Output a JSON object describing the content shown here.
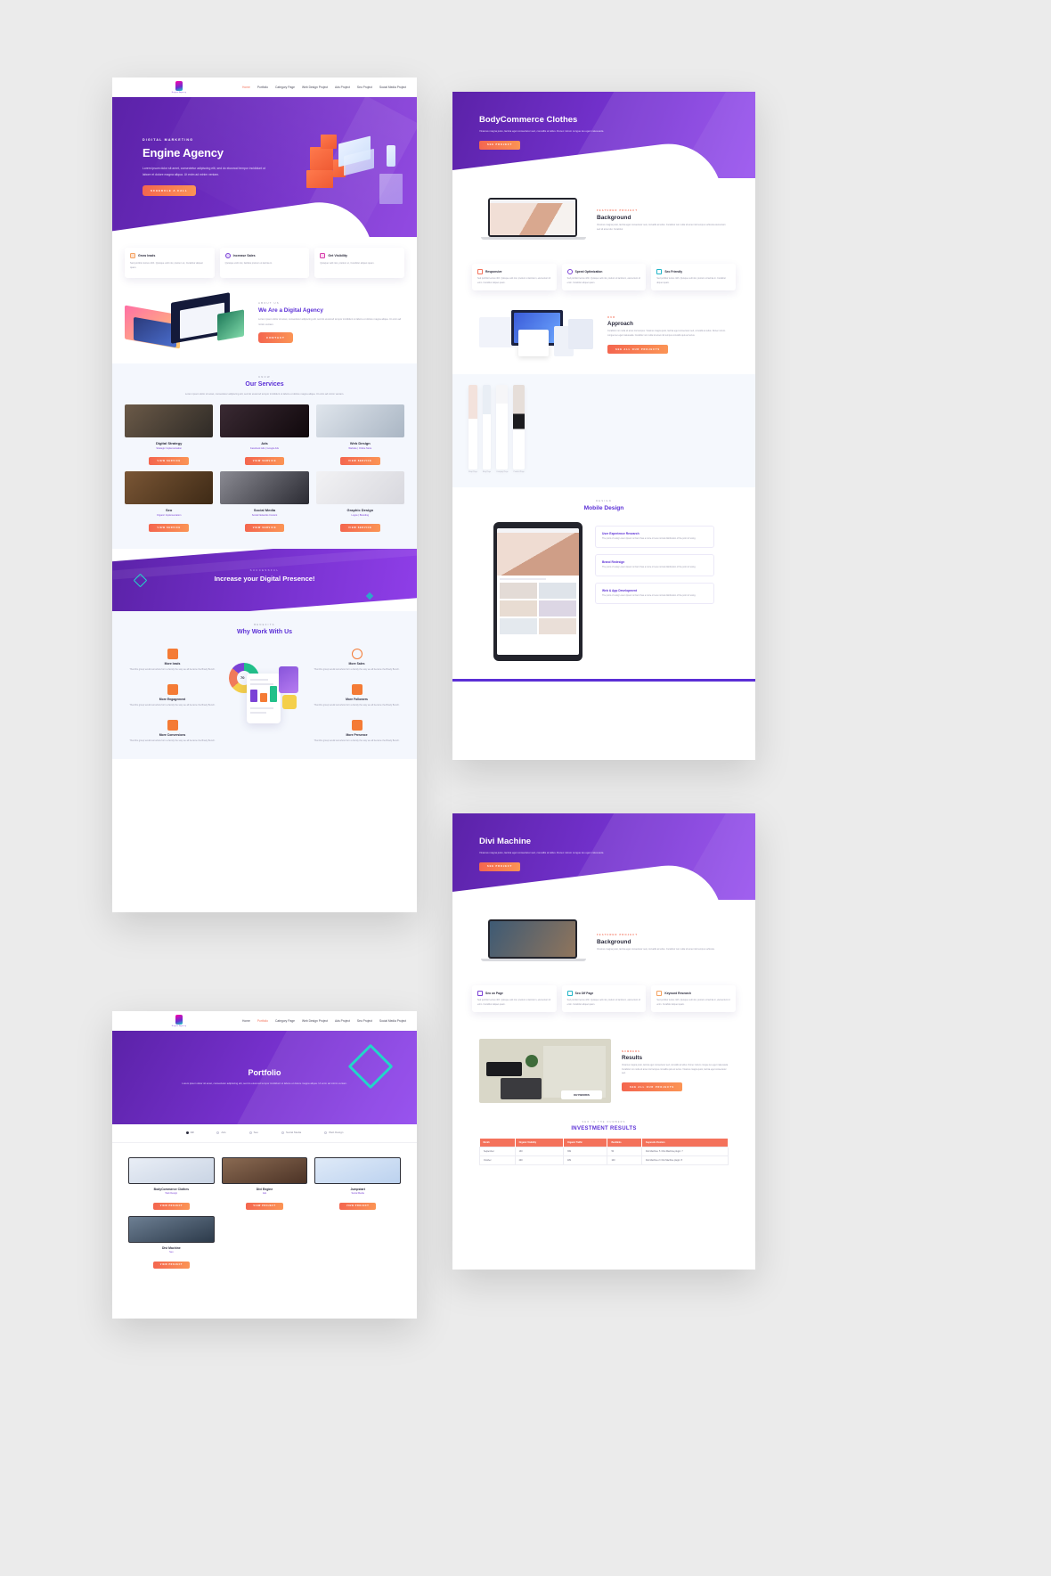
{
  "brand": {
    "logo_text": "Engine Agency",
    "accent_purple": "#5b2fd6",
    "accent_orange": "#f4725b",
    "accent_teal": "#22d6c8"
  },
  "nav": {
    "items": [
      {
        "label": "Home",
        "active": true
      },
      {
        "label": "Portfolio",
        "active": false
      },
      {
        "label": "Category Page",
        "active": false
      },
      {
        "label": "Web Design Project",
        "active": false
      },
      {
        "label": "Ads Project",
        "active": false
      },
      {
        "label": "Seo Project",
        "active": false
      },
      {
        "label": "Social Media Project",
        "active": false
      }
    ]
  },
  "home": {
    "hero": {
      "eyebrow": "DIGITAL MARKETING",
      "title": "Engine Agency",
      "body": "Lorem ipsum dolor sit amet, consectetur adipiscing elit, sed do eiusmod tempor incididunt ut labore et dolore magna aliqua. Ut enim ad minim veniam.",
      "cta": "Schedule A Call"
    },
    "features": [
      {
        "title": "Grow leads",
        "body": "Sed porttitor lectus nibh. Quisque velit nisi, pretium ut, Curabitur aliquet quam.",
        "icon": "briefcase-icon",
        "color": "#f4a261"
      },
      {
        "title": "Increase Sales",
        "body": "Quisque velit nisi, facilisis pretium ut lacinia in.",
        "icon": "headphones-icon",
        "color": "#7b42d6"
      },
      {
        "title": "Get Visibility",
        "body": "Quisque velit nisi, pretium ut, Curabitur aliquet quam.",
        "icon": "camera-icon",
        "color": "#d63dab"
      }
    ],
    "about": {
      "eyebrow": "ABOUT US",
      "title": "We Are a Digital Agency",
      "body": "Lorem ipsum dolor sit amet, consectetur adipiscing elit, sed do eiusmod tempor incididunt ut labore et dolore magna aliqua. Ut enim ad minim veniam.",
      "cta": "Contact"
    },
    "services": {
      "eyebrow": "KNOW",
      "title": "Our Services",
      "body": "Lorem ipsum dolor sit amet, consectetur adipiscing elit, sed do eiusmod tempor incididunt ut labore et dolore magna aliqua. Ut enim ad minim veniam.",
      "items": [
        {
          "name": "Digital Strategy",
          "sub": "Strategic Implementation",
          "cta": "View Service"
        },
        {
          "name": "Ads",
          "sub": "Facebook Ads | Google Ads",
          "cta": "View Service"
        },
        {
          "name": "Web Design",
          "sub": "Website | Online Store",
          "cta": "View Service"
        },
        {
          "name": "Seo",
          "sub": "Organic Implementation",
          "cta": "View Service"
        },
        {
          "name": "Social Media",
          "sub": "Social Networks Content",
          "cta": "View Service"
        },
        {
          "name": "Graphic Design",
          "sub": "Logos | Branding",
          "cta": "View Service"
        }
      ]
    },
    "cta_band": {
      "eyebrow": "SUCCESSFUL",
      "title": "Increase your Digital Presence!"
    },
    "benefits": {
      "eyebrow": "BENEFITS",
      "title": "Why Work With Us",
      "items": [
        {
          "name": "More leads",
          "body": "That this group would somehow form a family the way we all became the Brady Bunch.",
          "icon": "bar-chart-icon"
        },
        {
          "name": "More Engagement",
          "body": "That this group would somehow form a family the way we all became the Brady Bunch.",
          "icon": "trend-up-icon"
        },
        {
          "name": "More Conversions",
          "body": "That this group would somehow form a family the way we all became the Brady Bunch.",
          "icon": "cart-icon"
        },
        {
          "name": "More Sales",
          "body": "That this group would somehow form a family the way we all became the Brady Bunch.",
          "icon": "dollar-icon"
        },
        {
          "name": "More Followers",
          "body": "That this group would somehow form a family the way we all became the Brady Bunch.",
          "icon": "people-icon"
        },
        {
          "name": "More Presence",
          "body": "That this group would somehow form a family the way we all became the Brady Bunch.",
          "icon": "network-icon"
        }
      ],
      "chart_number": "70"
    }
  },
  "portfolio": {
    "title": "Portfolio",
    "subtitle": "Lorem ipsum dolor sit amet, consectetur adipiscing elit, sed do eiusmod tempor incididunt ut labore et dolore magna aliqua. Ut enim ad minim veniam.",
    "filters": [
      {
        "label": "All",
        "active": true
      },
      {
        "label": "Ads",
        "active": false
      },
      {
        "label": "Seo",
        "active": false
      },
      {
        "label": "Social Media",
        "active": false
      },
      {
        "label": "Web Design",
        "active": false
      }
    ],
    "items": [
      {
        "name": "BodyCommerce Clothes",
        "cat": "Web Design",
        "cta": "View Project"
      },
      {
        "name": "Divi Engine",
        "cat": "Ads",
        "cta": "View Project"
      },
      {
        "name": "Jumpstart",
        "cat": "Social Media",
        "cta": "View Project"
      },
      {
        "name": "Divi Machine",
        "cat": "Seo",
        "cta": "View Project"
      }
    ]
  },
  "project_body": {
    "hero": {
      "title": "BodyCommerce Clothes",
      "body": "Vivamus magna justo, lacinia eget consectetur sed, convallis at tellus. Donec rutrum congue leo eget malesuada.",
      "cta": "See Project"
    },
    "background": {
      "eyebrow": "FEATURED PROJECT",
      "title": "Background",
      "body": "Vivamus magna justo, lacinia eget consectetur sed, convallis at tellus. Curabitur non nulla sit amet nisl tempus vehicula elementum sed sit amet dui. Curabitur."
    },
    "features": [
      {
        "title": "Responsive",
        "body": "Sed porttitor lectus nibh. Quisque velit nisi, pretium ut lacinia in, elementum id enim. Curabitur aliquet quam.",
        "icon": "mobile-icon",
        "color": "#f4725b"
      },
      {
        "title": "Speed Optimization",
        "body": "Sed porttitor lectus nibh. Quisque velit nisi, pretium ut lacinia in, elementum id enim. Curabitur aliquet quam.",
        "icon": "gauge-icon",
        "color": "#7b42d6"
      },
      {
        "title": "Seo Friendly",
        "body": "Sed porttitor lectus nibh. Quisque velit nisi, pretium ut lacinia in. Curabitur aliquet quam.",
        "icon": "search-icon",
        "color": "#22b5c8"
      }
    ],
    "approach": {
      "eyebrow": "OUR",
      "title": "Approach",
      "body": "Curabitur non nulla sit amet nisl tempus. Vivamus magna justo, lacinia eget consectetur sed, convallis at tellus. Donec rutrum congue leo eget malesuada. Curabitur non nulla sit amet nisl tempus convallis quis ac lectus.",
      "cta": "See All Our Projects"
    },
    "gallery_captions": [
      "Shop Page",
      "Blog Page",
      "Category Page",
      "Product Page"
    ],
    "mobile": {
      "eyebrow": "DESIGN",
      "title": "Mobile Design",
      "cards": [
        {
          "title": "User Experience Research",
          "body": "The point of using Lorem Ipsum is that it has a more or less normal distribution of the point of using."
        },
        {
          "title": "Brand Redesign",
          "body": "The point of using Lorem Ipsum is that it has a more or less normal distribution of the point of using."
        },
        {
          "title": "Web & App Development",
          "body": "The point of using Lorem Ipsum is that it has a more or less normal distribution of the point of using."
        }
      ]
    }
  },
  "project_divi": {
    "hero": {
      "title": "Divi Machine",
      "body": "Vivamus magna justo, lacinia eget consectetur sed, convallis at tellus. Donec rutrum congue leo eget malesuada.",
      "cta": "See Project"
    },
    "background": {
      "eyebrow": "FEATURED PROJECT",
      "title": "Background",
      "body": "Vivamus magna justo, lacinia eget consectetur sed, convallis at tellus. Curabitur non nulla sit amet nisl tempus vehicula."
    },
    "features": [
      {
        "title": "Seo on Page",
        "body": "Sed porttitor lectus nibh. Quisque velit nisi, pretium ut lacinia in, elementum id enim. Curabitur aliquet quam.",
        "icon": "document-icon",
        "color": "#7b42d6"
      },
      {
        "title": "Seo Off Page",
        "body": "Sed porttitor lectus nibh. Quisque velit nisi, pretium ut lacinia in, elementum id enim. Curabitur aliquet quam.",
        "icon": "link-icon",
        "color": "#22b5c8"
      },
      {
        "title": "Keyword Research",
        "body": "Sed porttitor lectus nibh. Quisque velit nisi, pretium ut lacinia in, elementum id enim. Curabitur aliquet quam.",
        "icon": "key-icon",
        "color": "#f4a261"
      }
    ],
    "results": {
      "eyebrow": "NUMBERS",
      "title": "Results",
      "body": "Vivamus magna justo, lacinia eget consectetur sed, convallis at tellus. Donec rutrum congue leo eget malesuada. Curabitur non nulla sit amet nisl tempus convallis quis ac lectus. Vivamus magna justo, lacinia eget consectetur sed.",
      "cta": "See All Our Projects",
      "keyword_badge": "KEYWORDS"
    },
    "investment": {
      "eyebrow": "SEO IN THE NUMBERS",
      "title": "INVESTMENT RESULTS",
      "columns": [
        "Month",
        "Organic Visibility",
        "Organic Traffic",
        "Backlinks",
        "Keywords Position"
      ],
      "rows": [
        [
          "September",
          "130",
          "399",
          "50",
          "Divi Machine: 5 / Divi Machine plugin: 7"
        ],
        [
          "October",
          "200",
          "489",
          "100",
          "Divi Machine 2 / Divi Machine plugin: 5"
        ]
      ]
    }
  }
}
